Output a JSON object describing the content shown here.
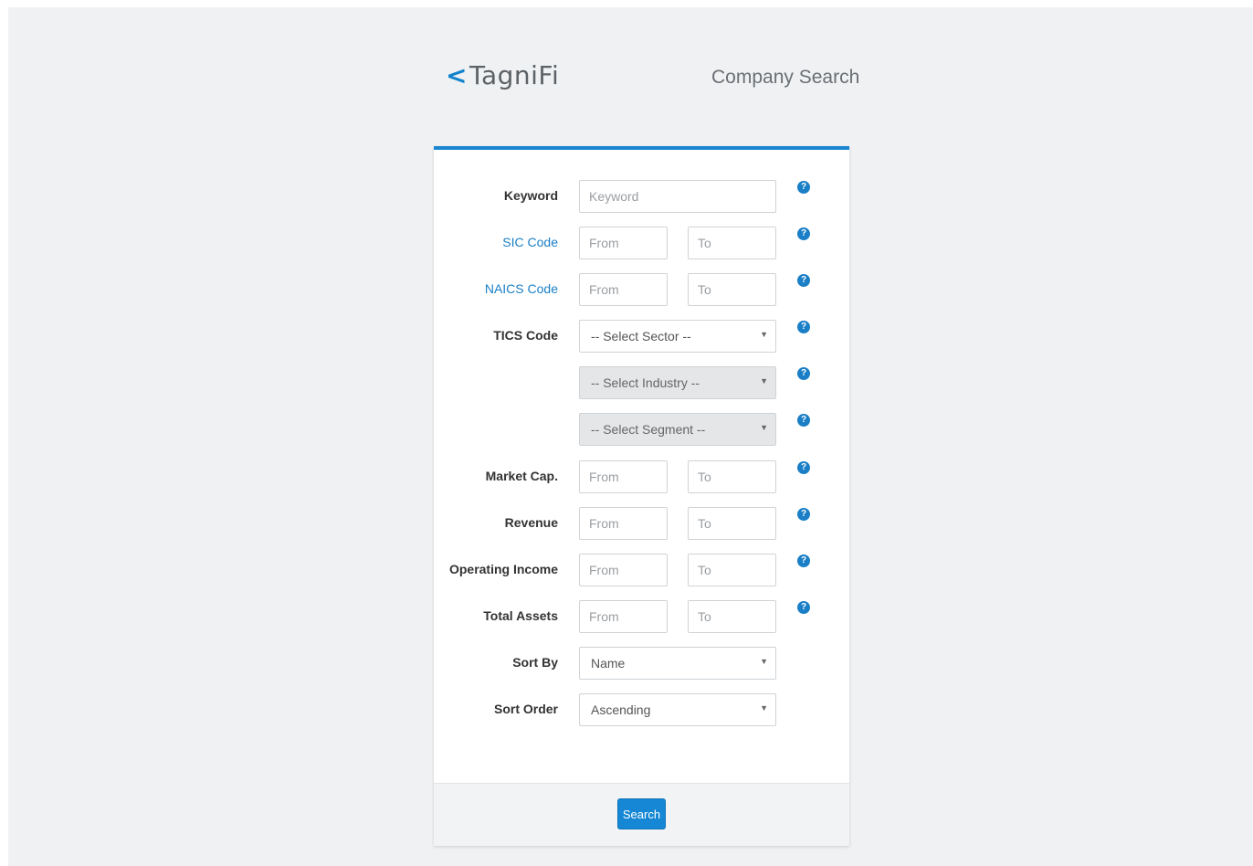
{
  "header": {
    "logo_chevron": "<",
    "logo_text": "TagniFi",
    "title": "Company Search"
  },
  "form": {
    "keyword": {
      "label": "Keyword",
      "placeholder": "Keyword"
    },
    "sic": {
      "label": "SIC Code",
      "from_placeholder": "From",
      "to_placeholder": "To"
    },
    "naics": {
      "label": "NAICS Code",
      "from_placeholder": "From",
      "to_placeholder": "To"
    },
    "tics": {
      "label": "TICS Code",
      "sector": "-- Select Sector --",
      "industry": "-- Select Industry --",
      "segment": "-- Select Segment --"
    },
    "market_cap": {
      "label": "Market Cap.",
      "from_placeholder": "From",
      "to_placeholder": "To"
    },
    "revenue": {
      "label": "Revenue",
      "from_placeholder": "From",
      "to_placeholder": "To"
    },
    "operating_income": {
      "label": "Operating Income",
      "from_placeholder": "From",
      "to_placeholder": "To"
    },
    "total_assets": {
      "label": "Total Assets",
      "from_placeholder": "From",
      "to_placeholder": "To"
    },
    "sort_by": {
      "label": "Sort By",
      "value": "Name"
    },
    "sort_order": {
      "label": "Sort Order",
      "value": "Ascending"
    }
  },
  "icons": {
    "help_glyph": "?",
    "dropdown_arrow": "▼"
  },
  "footer": {
    "search_label": "Search"
  },
  "colors": {
    "accent": "#1a86d0",
    "link": "#1a7fc6",
    "background": "#eff1f3"
  }
}
